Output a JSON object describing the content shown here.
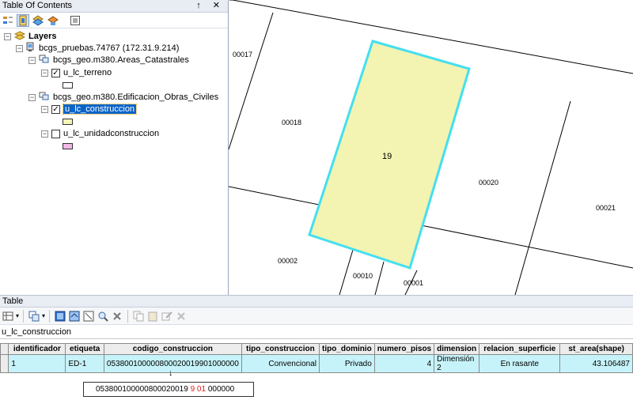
{
  "toc": {
    "title": "Table Of Contents",
    "controls": "↑ ✕",
    "toolbar_icons": [
      "list-by-drawing-order-icon",
      "list-by-source-icon",
      "list-by-visibility-icon",
      "list-by-selection-icon",
      "options-icon"
    ],
    "layers_label": "Layers",
    "connection_label": "bcgs_pruebas.74767 (172.31.9.214)",
    "groups": [
      {
        "name": "bcgs_geo.m380.Areas_Catastrales",
        "layer": {
          "name": "u_lc_terreno",
          "checked": true,
          "selected": false,
          "swatch_color": "#ffffff"
        }
      },
      {
        "name": "bcgs_geo.m380.Edificacion_Obras_Civiles",
        "layers": [
          {
            "name": "u_lc_construccion",
            "checked": true,
            "selected": true,
            "swatch_color": "#f5f5b8"
          },
          {
            "name": "u_lc_unidadconstruccion",
            "checked": false,
            "selected": false,
            "swatch_color": "#f2b8e8"
          }
        ]
      }
    ]
  },
  "map": {
    "labels": {
      "p00017": "00017",
      "p00018": "00018",
      "p19": "19",
      "p00020": "00020",
      "p00021": "00021",
      "p00002": "00002",
      "p00010": "00010",
      "p00001": "00001"
    },
    "highlight_fill": "#f3f3b2",
    "highlight_stroke": "#44dff0"
  },
  "table": {
    "title": "Table",
    "layer_tab": "u_lc_construccion",
    "columns": [
      "identificador",
      "etiqueta",
      "codigo_construccion",
      "tipo_construccion",
      "tipo_dominio",
      "numero_pisos",
      "dimension",
      "relacion_superficie",
      "st_area(shape)"
    ],
    "row": {
      "identificador": "1",
      "etiqueta": "ED-1",
      "codigo_construccion": "053800100000800020019901000000",
      "tipo_construccion": "Convencional",
      "tipo_dominio": "Privado",
      "numero_pisos": "4",
      "dimension": "Dimensión 2",
      "relacion_superficie": "En rasante",
      "st_area": "43.106487"
    },
    "row_color": "#c6f3f9"
  },
  "annotation": {
    "arrow": "↓",
    "code_prefix": "053800100000800020019",
    "code_mid1": "9",
    "code_mid2": "01",
    "code_suffix": "000000",
    "highlight_color": "#e01b1b"
  }
}
